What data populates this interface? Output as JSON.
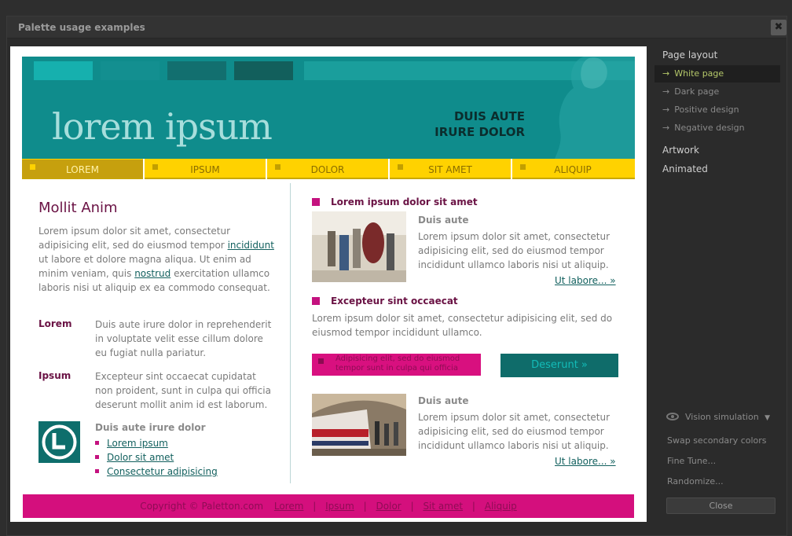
{
  "window": {
    "title": "Palette usage examples",
    "close_glyph": "✖"
  },
  "header": {
    "logo_text": "lorem ipsum",
    "tag_line1": "DUIS AUTE",
    "tag_line2": "IRURE DOLOR"
  },
  "nav": [
    {
      "label": "LOREM",
      "active": true
    },
    {
      "label": "IPSUM",
      "active": false
    },
    {
      "label": "DOLOR",
      "active": false
    },
    {
      "label": "SIT AMET",
      "active": false
    },
    {
      "label": "ALIQUIP",
      "active": false
    }
  ],
  "left": {
    "heading": "Mollit Anim",
    "para_part1": "Lorem ipsum dolor sit amet, consectetur adipisicing elit, sed do eiusmod tempor ",
    "para_link1": "incididunt",
    "para_part2": " ut labore et dolore magna aliqua. Ut enim ad minim veniam, quis ",
    "para_link2": "nostrud",
    "para_part3": " exercitation ullamco laboris nisi ut aliquip ex ea commodo consequat.",
    "def1_term": "Lorem",
    "def1_desc": "Duis aute irure dolor in reprehenderit in voluptate velit esse cillum dolore eu fugiat nulla pariatur.",
    "def2_term": "Ipsum",
    "def2_desc": "Excepteur sint occaecat cupidatat non proident, sunt in culpa qui officia deserunt mollit anim id est laborum.",
    "list_heading": "Duis aute irure dolor",
    "list": [
      "Lorem ipsum",
      "Dolor sit amet",
      "Consectetur adipisicing"
    ]
  },
  "right": {
    "section1_heading": "Lorem ipsum dolor sit amet",
    "article1_title": "Duis aute",
    "article1_text": "Lorem ipsum dolor sit amet, consectetur adipisicing elit, sed do eiusmod tempor incididunt ullamco laboris nisi ut aliquip.",
    "article1_more": "Ut labore... »",
    "section2_heading": "Excepteur sint occaecat",
    "section2_text": "Lorem ipsum dolor sit amet, consectetur adipisicing elit, sed do eiusmod tempor incididunt ullamco.",
    "pink_box_text": "Adipisicing elit, sed do eiusmod tempor sunt in culpa qui officia",
    "teal_button": "Deserunt »",
    "article2_title": "Duis aute",
    "article2_text": "Lorem ipsum dolor sit amet, consectetur adipisicing elit, sed do eiusmod tempor incididunt ullamco laboris nisi ut aliquip.",
    "article2_more": "Ut labore... »"
  },
  "footer": {
    "copyright": "Copyright © Paletton.com",
    "links": [
      "Lorem",
      "Ipsum",
      "Dolor",
      "Sit amet",
      "Aliquip"
    ],
    "separator": "|"
  },
  "sidebar": {
    "page_layout_heading": "Page layout",
    "layouts": [
      {
        "label": "White page",
        "selected": true
      },
      {
        "label": "Dark page",
        "selected": false
      },
      {
        "label": "Positive design",
        "selected": false
      },
      {
        "label": "Negative design",
        "selected": false
      }
    ],
    "arrow_glyph": "→",
    "artwork": "Artwork",
    "animated": "Animated",
    "vision_label": "Vision simulation",
    "vision_caret": "▼",
    "swap_label": "Swap secondary colors",
    "finetune_label": "Fine Tune...",
    "randomize_label": "Randomize...",
    "close_label": "Close"
  },
  "colors": {
    "teal": "#0f8c8c",
    "yellow": "#ffd200",
    "magenta": "#d40f7d",
    "plum": "#6a1244"
  }
}
